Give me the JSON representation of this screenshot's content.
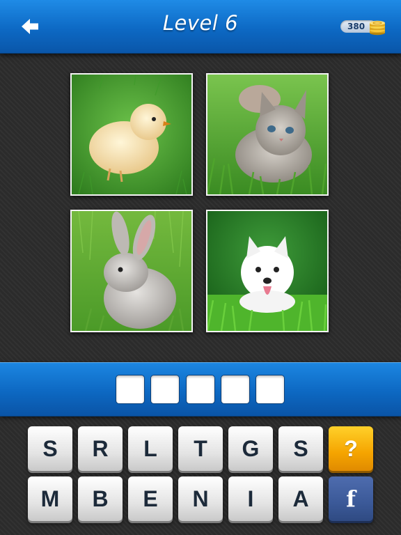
{
  "header": {
    "back_icon": "back-arrow-icon",
    "title": "Level 6",
    "coins": "380",
    "coin_icon": "coin-stack-icon"
  },
  "pictures": [
    {
      "subject": "chick"
    },
    {
      "subject": "kitten"
    },
    {
      "subject": "rabbit"
    },
    {
      "subject": "puppy"
    }
  ],
  "answer": {
    "slots": [
      "",
      "",
      "",
      "",
      ""
    ]
  },
  "keyboard": {
    "row1": [
      "S",
      "R",
      "L",
      "T",
      "G",
      "S"
    ],
    "row2": [
      "M",
      "B",
      "E",
      "N",
      "I",
      "A"
    ],
    "hint_label": "?",
    "facebook_label": "f"
  },
  "colors": {
    "header_blue": "#0d69c4",
    "hint_orange": "#f5a400",
    "facebook_blue": "#3b5998"
  }
}
